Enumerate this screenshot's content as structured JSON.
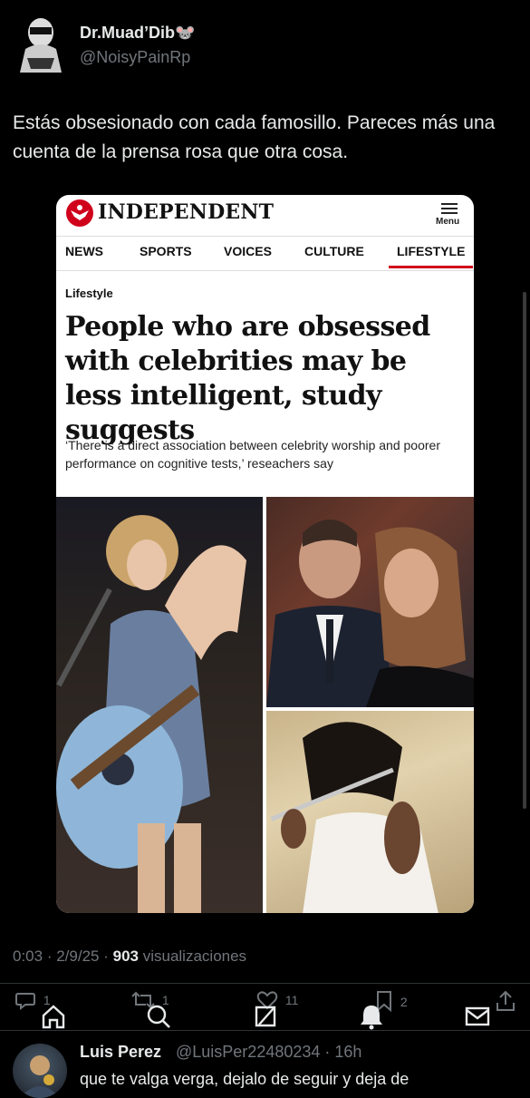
{
  "tweet": {
    "display_name": "Dr.Muad’Dib🐭",
    "handle": "@NoisyPainRp",
    "text": "Estás obsesionado con cada famosillo. Pareces más una cuenta de la prensa rosa que otra cosa.",
    "time": "0:03",
    "date": "2/9/25",
    "views_count": "903",
    "views_label": "visualizaciones",
    "counts": {
      "replies": "1",
      "reposts": "1",
      "likes": "11",
      "bookmarks": "2"
    }
  },
  "article": {
    "brand": "INDEPENDENT",
    "menu_label": "Menu",
    "nav": [
      "NEWS",
      "SPORTS",
      "VOICES",
      "CULTURE",
      "LIFESTYLE"
    ],
    "section": "Lifestyle",
    "headline": "People who are obsessed with celebrities may be less intelligent, study suggests",
    "standfirst": "‘There is a direct association between celebrity worship and poorer performance on cognitive tests,’ reseachers say",
    "accent": "#d0021b"
  },
  "reply": {
    "name": "Luis Perez",
    "handle": "@LuisPer22480234",
    "age": "16h",
    "text": "que te valga verga, dejalo de seguir y deja de"
  },
  "icons": [
    "reply-icon",
    "repost-icon",
    "like-icon",
    "bookmark-icon",
    "share-icon",
    "home-icon",
    "search-icon",
    "grok-icon",
    "notifications-icon",
    "messages-icon"
  ]
}
